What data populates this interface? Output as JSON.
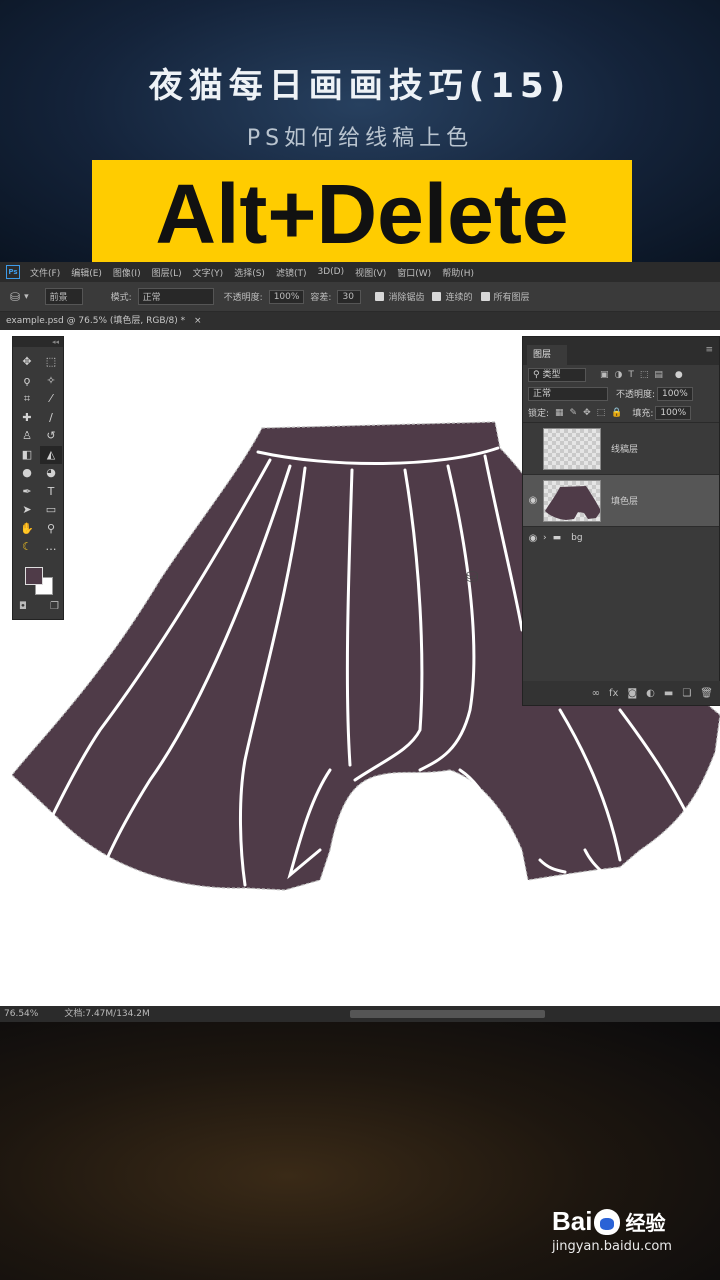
{
  "header": {
    "title": "夜猫每日画画技巧(15)",
    "subtitle": "PS如何给线稿上色",
    "shortcut": "Alt+Delete"
  },
  "app": {
    "logo": "Ps",
    "menu": [
      "文件(F)",
      "编辑(E)",
      "图像(I)",
      "图层(L)",
      "文字(Y)",
      "选择(S)",
      "滤镜(T)",
      "3D(D)",
      "视图(V)",
      "窗口(W)",
      "帮助(H)"
    ],
    "options": {
      "fill_source": "前景",
      "mode_label": "模式:",
      "mode_value": "正常",
      "opacity_label": "不透明度:",
      "opacity_value": "100%",
      "tolerance_label": "容差:",
      "tolerance_value": "30",
      "antialias_label": "消除锯齿",
      "contiguous_label": "连续的",
      "all_layers_label": "所有图层"
    },
    "document_tab": "example.psd @ 76.5% (填色层, RGB/8) *",
    "status": {
      "zoom": "76.54%",
      "doc_size": "文档:7.47M/134.2M"
    }
  },
  "layers_panel": {
    "tab": "图层",
    "filter_value": "类型",
    "blend_mode": "正常",
    "opacity_label": "不透明度:",
    "opacity_value": "100%",
    "lock_label": "锁定:",
    "fill_label": "填充:",
    "fill_value": "100%",
    "layers": [
      {
        "name": "线稿层",
        "visible": false,
        "selected": false
      },
      {
        "name": "填色层",
        "visible": true,
        "selected": true
      }
    ],
    "group": {
      "name": "bg",
      "visible": true
    }
  },
  "colors": {
    "skirt_fill": "#4f3b48",
    "foreground": "#4f3b48",
    "background": "#ffffff",
    "highlight": "#ffcc00"
  },
  "watermark": {
    "brand": "Bai",
    "brand_suffix": "经验",
    "url": "jingyan.baidu.com"
  }
}
